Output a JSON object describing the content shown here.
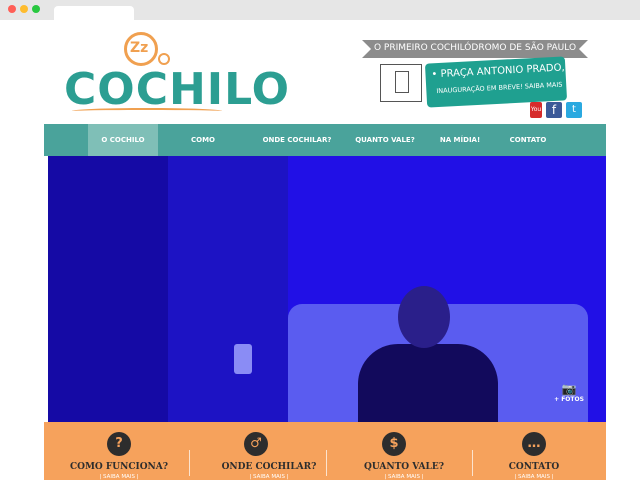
{
  "header": {
    "logo": {
      "zz": "Zz",
      "text": "COCHILO"
    },
    "banner": "O PRIMEIRO COCHILÓDROMO DE SÃO PAULO",
    "address": {
      "line1": "• PRAÇA ANTONIO PRADO, 33",
      "line2": "INAUGURAÇÃO EM BREVE! SAIBA MAIS"
    },
    "social": {
      "youtube": "You Tube",
      "facebook": "f",
      "twitter": "t"
    }
  },
  "nav": {
    "items": [
      {
        "label": "O COCHILO",
        "active": true
      },
      {
        "label": "COMO FUNCIONA?",
        "active": false
      },
      {
        "label": "ONDE COCHILAR?",
        "active": false
      },
      {
        "label": "QUANTO VALE?",
        "active": false
      },
      {
        "label": "NA MÍDIA!",
        "active": false
      },
      {
        "label": "CONTATO",
        "active": false
      }
    ]
  },
  "hero": {
    "fotos_label": "+ FOTOS",
    "fotos_icon": "camera-icon"
  },
  "features": [
    {
      "icon": "?",
      "icon_name": "question-icon",
      "title": "COMO FUNCIONA?",
      "link": "| SAIBA MAIS |"
    },
    {
      "icon": "♂",
      "icon_name": "map-pin-icon",
      "title": "ONDE COCHILAR?",
      "link": "| SAIBA MAIS |"
    },
    {
      "icon": "$",
      "icon_name": "dollar-icon",
      "title": "QUANTO VALE?",
      "link": "| SAIBA MAIS |"
    },
    {
      "icon": "…",
      "icon_name": "speech-bubble-icon",
      "title": "CONTATO",
      "link": "| SAIBA MAIS |"
    }
  ],
  "colors": {
    "teal": "#4aa39b",
    "teal_dark": "#2c9e92",
    "orange": "#f6a25c",
    "hero_blue": "#1c0fd8"
  }
}
